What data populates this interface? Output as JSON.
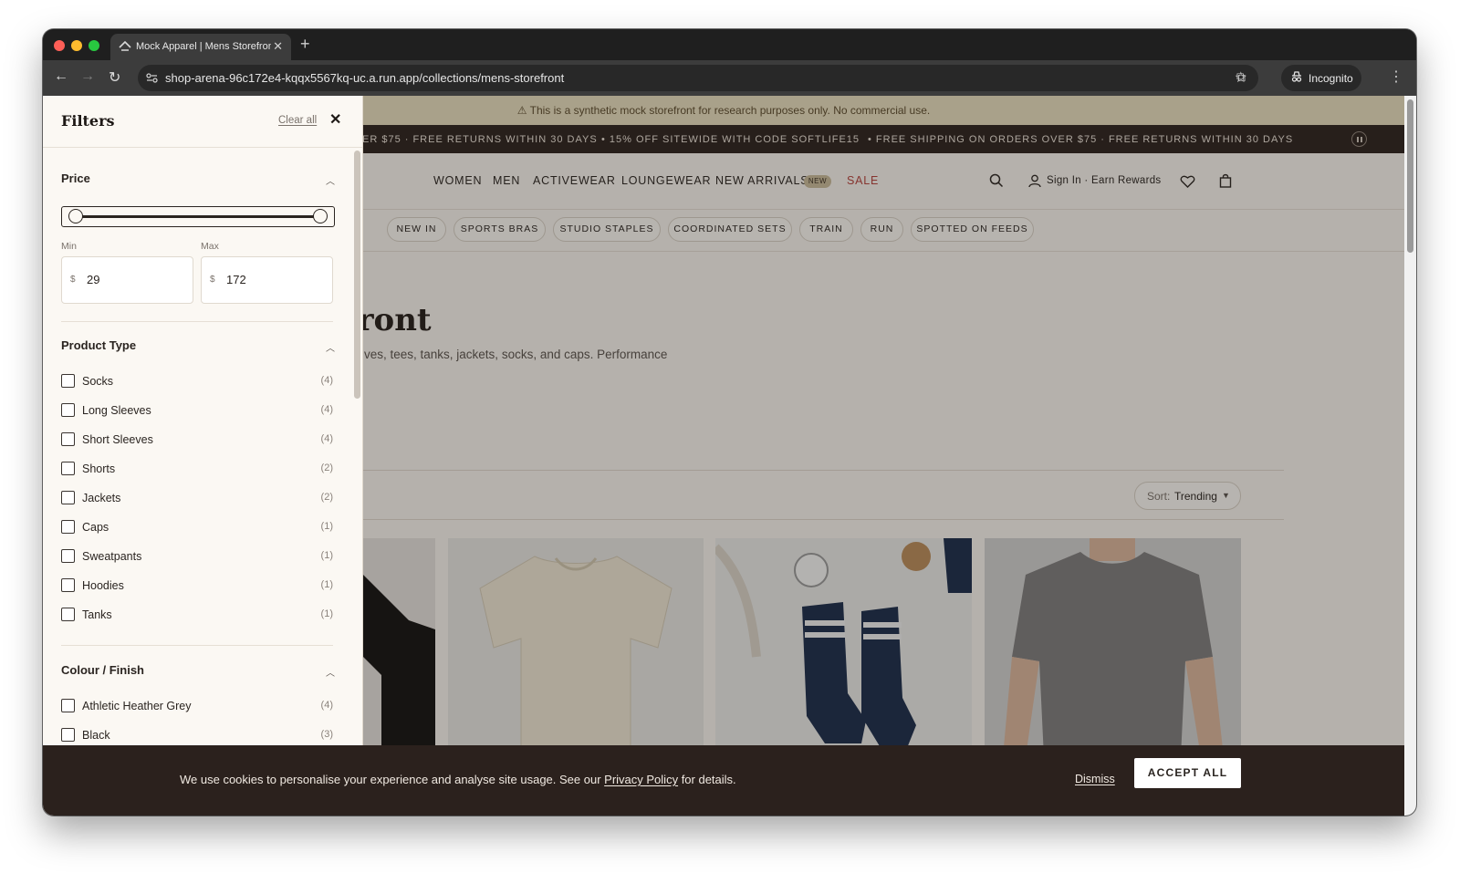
{
  "browser": {
    "tab_title": "Mock Apparel | Mens Storefront",
    "url": "shop-arena-96c172e4-kqqx5567kq-uc.a.run.app/collections/mens-storefront",
    "incognito_label": "Incognito"
  },
  "banner": {
    "text": "⚠ This is a synthetic mock storefront for research purposes only. No commercial use."
  },
  "ticker": {
    "items": [
      "ER $75 · FREE RETURNS WITHIN 30 DAYS",
      "•  15% OFF SITEWIDE WITH CODE SOFTLIFE15",
      "•  FREE SHIPPING ON ORDERS OVER $75 · FREE RETURNS WITHIN 30 DAYS"
    ]
  },
  "nav": {
    "items": [
      "WOMEN",
      "MEN",
      "ACTIVEWEAR",
      "LOUNGEWEAR",
      "NEW ARRIVALS",
      "SALE"
    ],
    "new_badge": "NEW",
    "sign_in": "Sign In · Earn Rewards",
    "sale_color": "#b4403a"
  },
  "subnav": {
    "pills": [
      "NEW IN",
      "SPORTS BRAS",
      "STUDIO STAPLES",
      "COORDINATED SETS",
      "TRAIN",
      "RUN",
      "SPOTTED ON FEEDS"
    ]
  },
  "collection": {
    "title": "front",
    "description": "ves, tees, tanks, jackets, socks, and caps. Performance"
  },
  "sort": {
    "label": "Sort:",
    "value": "Trending"
  },
  "filters": {
    "title": "Filters",
    "clear_all": "Clear all",
    "price": {
      "heading": "Price",
      "min_label": "Min",
      "max_label": "Max",
      "currency": "$",
      "min": "29",
      "max": "172",
      "range_low": 0,
      "range_high": 1
    },
    "product_type": {
      "heading": "Product Type",
      "options": [
        {
          "name": "Socks",
          "count": "(4)"
        },
        {
          "name": "Long Sleeves",
          "count": "(4)"
        },
        {
          "name": "Short Sleeves",
          "count": "(4)"
        },
        {
          "name": "Shorts",
          "count": "(2)"
        },
        {
          "name": "Jackets",
          "count": "(2)"
        },
        {
          "name": "Caps",
          "count": "(1)"
        },
        {
          "name": "Sweatpants",
          "count": "(1)"
        },
        {
          "name": "Hoodies",
          "count": "(1)"
        },
        {
          "name": "Tanks",
          "count": "(1)"
        }
      ]
    },
    "colour": {
      "heading": "Colour / Finish",
      "options": [
        {
          "name": "Athletic Heather Grey",
          "count": "(4)"
        },
        {
          "name": "Black",
          "count": "(3)"
        }
      ]
    }
  },
  "cookie": {
    "text_before": "We use cookies to personalise your experience and analyse site usage. See our ",
    "link": "Privacy Policy",
    "text_after": " for details.",
    "dismiss": "Dismiss",
    "accept": "ACCEPT ALL"
  }
}
